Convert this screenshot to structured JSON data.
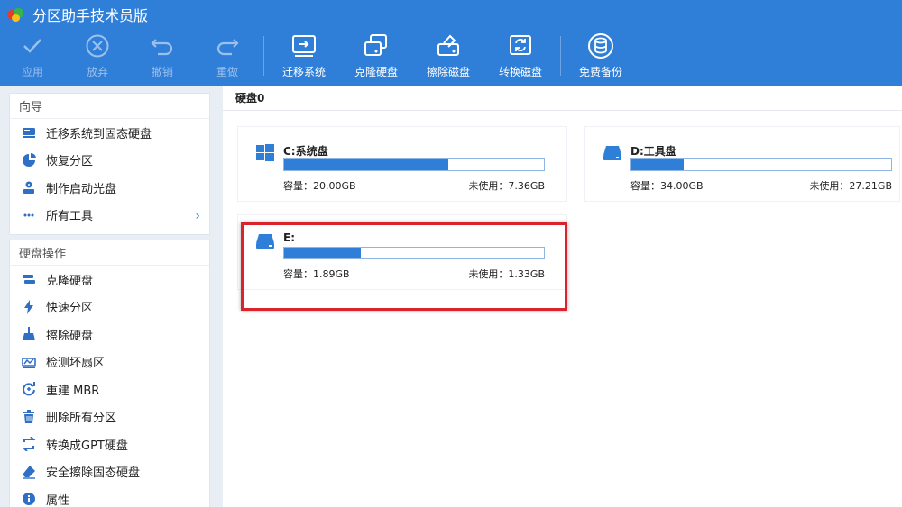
{
  "app": {
    "title": "分区助手技术员版"
  },
  "toolbar": {
    "items": [
      {
        "label": "应用",
        "icon": "check-icon",
        "enabled": false
      },
      {
        "label": "放弃",
        "icon": "cancel-circle-icon",
        "enabled": false
      },
      {
        "label": "撤销",
        "icon": "undo-icon",
        "enabled": false
      },
      {
        "label": "重做",
        "icon": "redo-icon",
        "enabled": false
      },
      {
        "label": "迁移系统",
        "icon": "migrate-os-icon",
        "enabled": true
      },
      {
        "label": "克隆硬盘",
        "icon": "clone-disk-icon",
        "enabled": true
      },
      {
        "label": "擦除磁盘",
        "icon": "wipe-disk-icon",
        "enabled": true
      },
      {
        "label": "转换磁盘",
        "icon": "convert-disk-icon",
        "enabled": true
      },
      {
        "label": "免费备份",
        "icon": "backup-icon",
        "enabled": true
      }
    ]
  },
  "sidebar": {
    "guide": {
      "title": "向导",
      "items": [
        {
          "label": "迁移系统到固态硬盘",
          "icon": "ssd-migrate-icon"
        },
        {
          "label": "恢复分区",
          "icon": "recover-partition-icon"
        },
        {
          "label": "制作启动光盘",
          "icon": "bootable-disc-icon"
        },
        {
          "label": "所有工具",
          "icon": "tools-icon"
        }
      ]
    },
    "ops": {
      "title": "硬盘操作",
      "items": [
        {
          "label": "克隆硬盘",
          "icon": "clone-icon"
        },
        {
          "label": "快速分区",
          "icon": "lightning-icon"
        },
        {
          "label": "擦除硬盘",
          "icon": "broom-icon"
        },
        {
          "label": "检测坏扇区",
          "icon": "scan-sector-icon"
        },
        {
          "label": "重建 MBR",
          "icon": "rebuild-mbr-icon"
        },
        {
          "label": "删除所有分区",
          "icon": "trash-icon"
        },
        {
          "label": "转换成GPT硬盘",
          "icon": "convert-gpt-icon"
        },
        {
          "label": "安全擦除固态硬盘",
          "icon": "eraser-icon"
        },
        {
          "label": "属性",
          "icon": "info-icon"
        }
      ]
    }
  },
  "main": {
    "disk_title": "硬盘0",
    "partitions": [
      {
        "name": "C:系统盘",
        "capacity": "容量：20.00GB",
        "free": "未使用：7.36GB",
        "used_fraction": 0.632,
        "icon": "windows-icon"
      },
      {
        "name": "D:工具盘",
        "capacity": "容量：34.00GB",
        "free": "未使用：27.21GB",
        "used_fraction": 0.2,
        "icon": "drive-icon"
      },
      {
        "name": "E:",
        "capacity": "容量：1.89GB",
        "free": "未使用：1.33GB",
        "used_fraction": 0.296,
        "icon": "drive-icon"
      }
    ]
  },
  "colors": {
    "accent": "#2f7fd9",
    "highlight": "#d9232d"
  }
}
